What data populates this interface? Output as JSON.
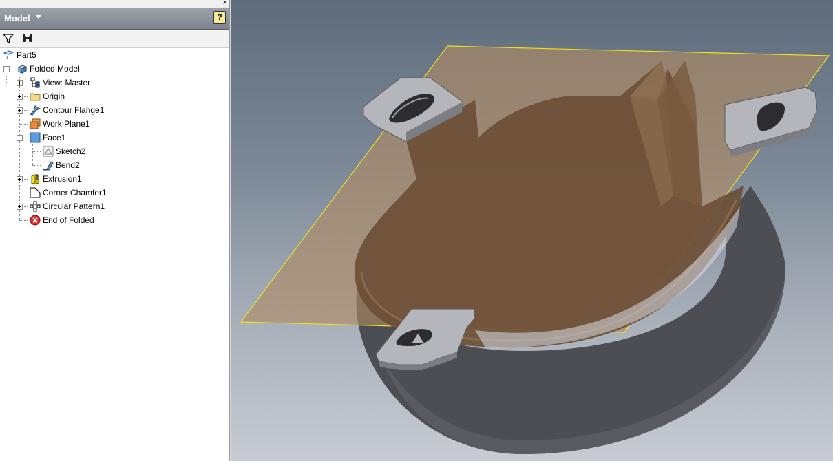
{
  "panel": {
    "close_label": "×",
    "title": "Model",
    "help_label": "?"
  },
  "toolbar": {
    "filter_icon": "filter-icon",
    "find_icon": "binoculars-icon"
  },
  "tree": {
    "root": "Part5",
    "items": [
      {
        "label": "Folded Model"
      },
      {
        "label": "View: Master"
      },
      {
        "label": "Origin"
      },
      {
        "label": "Contour Flange1"
      },
      {
        "label": "Work Plane1"
      },
      {
        "label": "Face1"
      },
      {
        "label": "Sketch2"
      },
      {
        "label": "Bend2"
      },
      {
        "label": "Extrusion1"
      },
      {
        "label": "Corner Chamfer1"
      },
      {
        "label": "Circular Pattern1"
      },
      {
        "label": "End of Folded"
      }
    ]
  },
  "colors": {
    "header": "#8a9098",
    "plane_outline": "#f0e020",
    "plane_fill": "#b08a63",
    "sheet_metal": "#b5b6bb",
    "cylinder_dark": "#4d4e53"
  }
}
